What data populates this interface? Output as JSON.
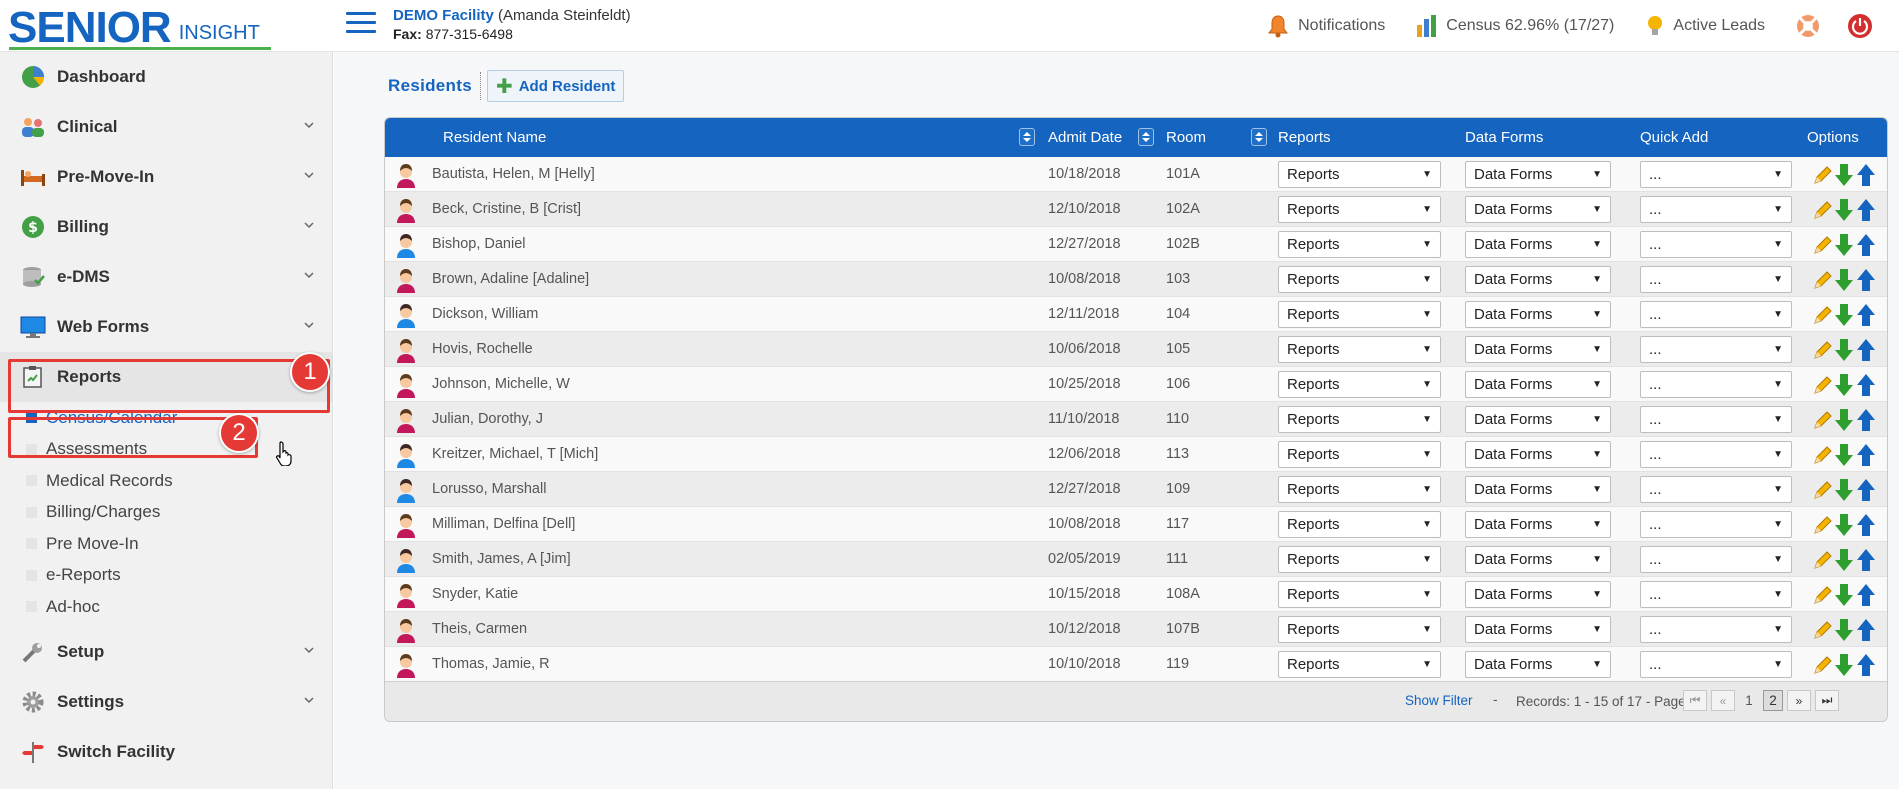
{
  "header": {
    "logo_main": "SENIOR",
    "logo_sub": "INSIGHT",
    "facility_name": "DEMO Facility",
    "facility_user": "(Amanda Steinfeldt)",
    "fax_label": "Fax:",
    "fax_number": "877-315-6498",
    "notifications_label": "Notifications",
    "census_label": "Census 62.96% (17/27)",
    "leads_label": "Active Leads"
  },
  "sidebar": {
    "items": [
      {
        "label": "Dashboard"
      },
      {
        "label": "Clinical"
      },
      {
        "label": "Pre-Move-In"
      },
      {
        "label": "Billing"
      },
      {
        "label": "e-DMS"
      },
      {
        "label": "Web Forms"
      },
      {
        "label": "Reports"
      }
    ],
    "reports_sub": [
      {
        "label": "Census/Calendar"
      },
      {
        "label": "Assessments"
      },
      {
        "label": "Medical Records"
      },
      {
        "label": "Billing/Charges"
      },
      {
        "label": "Pre Move-In"
      },
      {
        "label": "e-Reports"
      },
      {
        "label": "Ad-hoc"
      }
    ],
    "bottom_items": [
      {
        "label": "Setup"
      },
      {
        "label": "Settings"
      },
      {
        "label": "Switch Facility"
      }
    ]
  },
  "callouts": {
    "one": "1",
    "two": "2"
  },
  "page": {
    "title": "Residents",
    "add_button": "Add Resident"
  },
  "table": {
    "columns": {
      "name": "Resident Name",
      "admit": "Admit Date",
      "room": "Room",
      "reports": "Reports",
      "forms": "Data Forms",
      "quick": "Quick Add",
      "options": "Options"
    },
    "rows": [
      {
        "name": "Bautista, Helen, M [Helly]",
        "admit": "10/18/2018",
        "room": "101A",
        "gender": "f"
      },
      {
        "name": "Beck, Cristine, B [Crist]",
        "admit": "12/10/2018",
        "room": "102A",
        "gender": "f"
      },
      {
        "name": "Bishop, Daniel",
        "admit": "12/27/2018",
        "room": "102B",
        "gender": "m"
      },
      {
        "name": "Brown, Adaline [Adaline]",
        "admit": "10/08/2018",
        "room": "103",
        "gender": "f"
      },
      {
        "name": "Dickson, William",
        "admit": "12/11/2018",
        "room": "104",
        "gender": "m"
      },
      {
        "name": "Hovis, Rochelle",
        "admit": "10/06/2018",
        "room": "105",
        "gender": "f"
      },
      {
        "name": "Johnson, Michelle, W",
        "admit": "10/25/2018",
        "room": "106",
        "gender": "f"
      },
      {
        "name": "Julian, Dorothy, J",
        "admit": "11/10/2018",
        "room": "110",
        "gender": "f"
      },
      {
        "name": "Kreitzer, Michael, T [Mich]",
        "admit": "12/06/2018",
        "room": "113",
        "gender": "m"
      },
      {
        "name": "Lorusso, Marshall",
        "admit": "12/27/2018",
        "room": "109",
        "gender": "m"
      },
      {
        "name": "Milliman, Delfina [Dell]",
        "admit": "10/08/2018",
        "room": "117",
        "gender": "f"
      },
      {
        "name": "Smith, James, A [Jim]",
        "admit": "02/05/2019",
        "room": "111",
        "gender": "m"
      },
      {
        "name": "Snyder, Katie",
        "admit": "10/15/2018",
        "room": "108A",
        "gender": "f"
      },
      {
        "name": "Theis, Carmen",
        "admit": "10/12/2018",
        "room": "107B",
        "gender": "f"
      },
      {
        "name": "Thomas, Jamie, R",
        "admit": "10/10/2018",
        "room": "119",
        "gender": "f"
      }
    ],
    "reports_select": "Reports",
    "forms_select": "Data Forms",
    "quick_select": "..."
  },
  "footer": {
    "show_filter": "Show Filter",
    "dash": "-",
    "records": "Records: 1 - 15 of 17 - Pages:",
    "page1": "1",
    "page2": "2"
  },
  "colors": {
    "brand": "#1565c0",
    "accent_green": "#4caf50",
    "callout_red": "#e53935"
  }
}
